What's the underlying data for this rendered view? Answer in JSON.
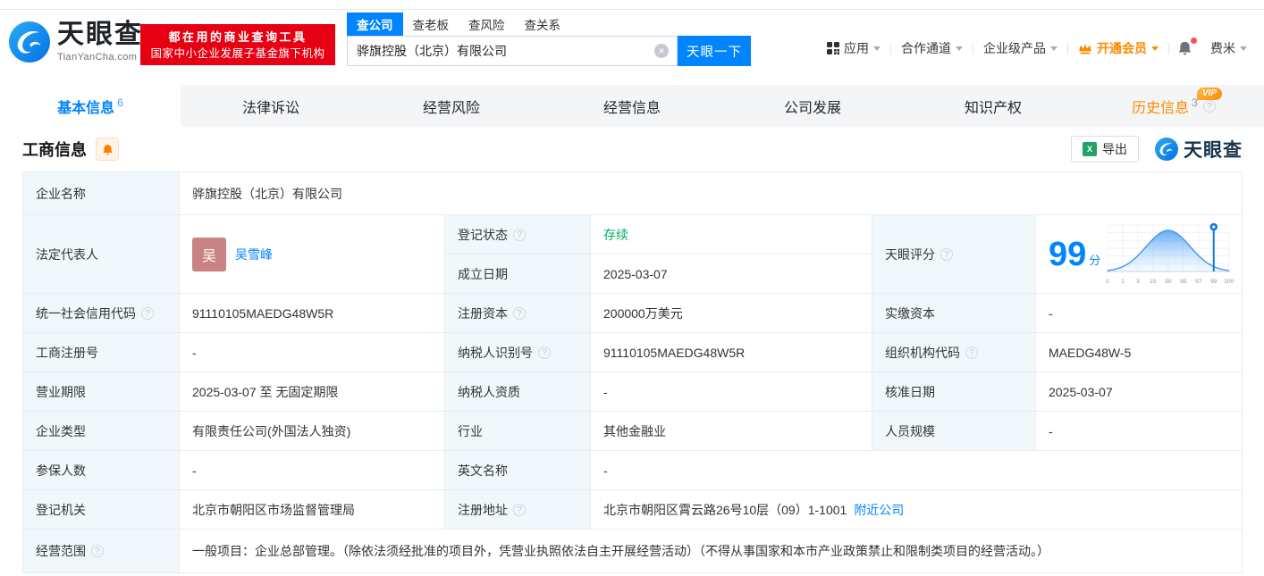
{
  "brand": {
    "name": "天眼查",
    "domain": "TianYanCha.com",
    "primary_color": "#0084ff",
    "slogan_line1": "都在用的商业查询工具",
    "slogan_line2": "国家中小企业发展子基金旗下机构",
    "slogan_bg": "#e60012"
  },
  "search": {
    "tabs": [
      {
        "label": "查公司",
        "active": true
      },
      {
        "label": "查老板",
        "active": false
      },
      {
        "label": "查风险",
        "active": false
      },
      {
        "label": "查关系",
        "active": false
      }
    ],
    "value": "骅旗控股（北京）有限公司",
    "button_label": "天眼一下"
  },
  "top_nav": {
    "apps": "应用",
    "partner": "合作通道",
    "enterprise": "企业级产品",
    "vip": "开通会员",
    "user": "费米"
  },
  "page_tabs": [
    {
      "label": "基本信息",
      "count": "6",
      "state": "active"
    },
    {
      "label": "法律诉讼",
      "count": "",
      "state": "normal"
    },
    {
      "label": "经营风险",
      "count": "",
      "state": "normal"
    },
    {
      "label": "经营信息",
      "count": "",
      "state": "normal"
    },
    {
      "label": "公司发展",
      "count": "",
      "state": "normal"
    },
    {
      "label": "知识产权",
      "count": "",
      "state": "normal"
    },
    {
      "label": "历史信息",
      "count": "3",
      "state": "vip",
      "badge": "VIP"
    }
  ],
  "section": {
    "title": "工商信息",
    "export_label": "导出",
    "watermark": "天眼查"
  },
  "table": {
    "company_name": {
      "label": "企业名称",
      "value": "骅旗控股（北京）有限公司"
    },
    "legal_rep": {
      "label": "法定代表人",
      "avatar_text": "吴",
      "value": "吴雪峰"
    },
    "reg_status": {
      "label": "登记状态",
      "value": "存续",
      "value_color": "#00b05c"
    },
    "establish_date": {
      "label": "成立日期",
      "value": "2025-03-07"
    },
    "score_label": "天眼评分",
    "credit_code": {
      "label": "统一社会信用代码",
      "value": "91110105MAEDG48W5R"
    },
    "reg_capital": {
      "label": "注册资本",
      "value": "200000万美元"
    },
    "paid_capital": {
      "label": "实缴资本",
      "value": "-"
    },
    "reg_number": {
      "label": "工商注册号",
      "value": "-"
    },
    "taxpayer_id": {
      "label": "纳税人识别号",
      "value": "91110105MAEDG48W5R"
    },
    "org_code": {
      "label": "组织机构代码",
      "value": "MAEDG48W-5"
    },
    "business_term": {
      "label": "营业期限",
      "value": "2025-03-07 至 无固定期限"
    },
    "taxpayer_quality": {
      "label": "纳税人资质",
      "value": "-"
    },
    "approval_date": {
      "label": "核准日期",
      "value": "2025-03-07"
    },
    "company_type": {
      "label": "企业类型",
      "value": "有限责任公司(外国法人独资)"
    },
    "industry": {
      "label": "行业",
      "value": "其他金融业"
    },
    "staff_size": {
      "label": "人员规模",
      "value": "-"
    },
    "insured_count": {
      "label": "参保人数",
      "value": "-"
    },
    "english_name": {
      "label": "英文名称",
      "value": "-"
    },
    "reg_authority": {
      "label": "登记机关",
      "value": "北京市朝阳区市场监督管理局"
    },
    "reg_address": {
      "label": "注册地址",
      "value": "北京市朝阳区霄云路26号10层（09）1-1001",
      "link_label": "附近公司"
    },
    "business_scope": {
      "label": "经营范围",
      "value": "一般项目：企业总部管理。（除依法须经批准的项目外，凭营业执照依法自主开展经营活动）（不得从事国家和本市产业政策禁止和限制类项目的经营活动。）"
    }
  },
  "chart_data": {
    "type": "area",
    "title": "天眼评分",
    "score": "99",
    "score_unit": "分",
    "x_ticks": [
      "0",
      "1",
      "3",
      "15",
      "50",
      "85",
      "97",
      "99",
      "100"
    ],
    "marker_tick": "99",
    "peak_tick": "50",
    "ylim": [
      0,
      1
    ],
    "grid": true,
    "accent_color": "#1677e0"
  }
}
